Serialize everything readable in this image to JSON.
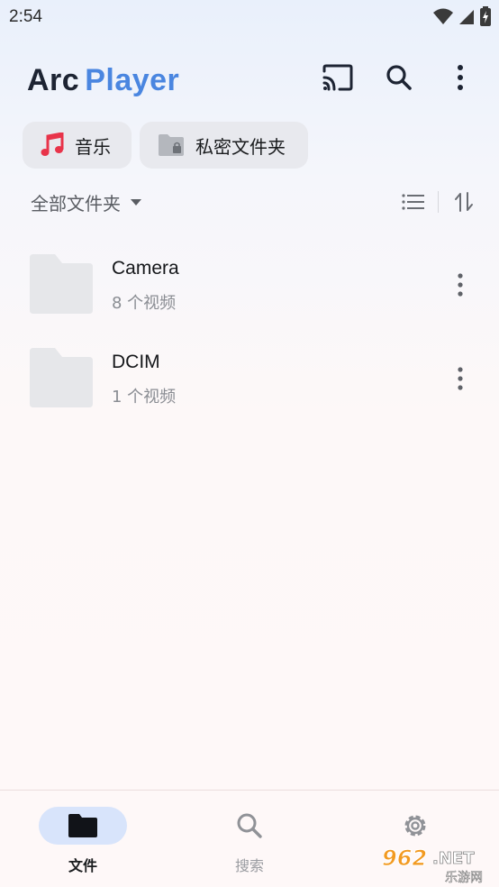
{
  "status_bar": {
    "time": "2:54"
  },
  "header": {
    "title_part1": "Arc",
    "title_part2": "Player",
    "actions": [
      "cast-icon",
      "search-icon",
      "more-vert-icon"
    ]
  },
  "chips": [
    {
      "label": "音乐",
      "icon": "music-note-icon",
      "icon_color": "#e8344a"
    },
    {
      "label": "私密文件夹",
      "icon": "locked-folder-icon"
    }
  ],
  "filter": {
    "label": "全部文件夹"
  },
  "folders": [
    {
      "name": "Camera",
      "count": "8 个视频"
    },
    {
      "name": "DCIM",
      "count": "1 个视频"
    }
  ],
  "bottom_nav": [
    {
      "label": "文件",
      "icon": "folder-icon",
      "active": true
    },
    {
      "label": "搜索",
      "icon": "search-icon",
      "active": false
    },
    {
      "label": "",
      "icon": "settings-icon",
      "active": false
    }
  ],
  "watermark": {
    "text_top": "962.NET",
    "text_bottom": "乐游网"
  },
  "colors": {
    "accent": "#4a86e0",
    "active_pill": "#d8e4fb",
    "folder": "#e6e7ea"
  }
}
